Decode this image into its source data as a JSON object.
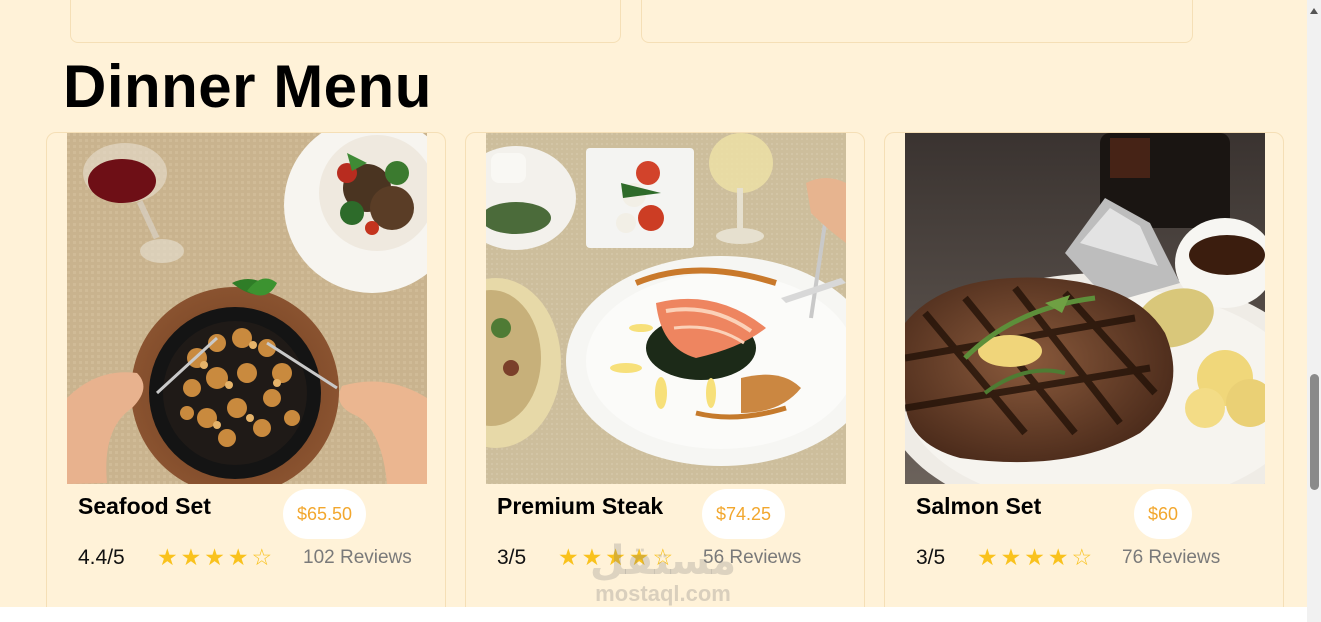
{
  "section": {
    "title": "Dinner Menu"
  },
  "menu_items": [
    {
      "name": "Seafood Set",
      "price": "$65.50",
      "rating": "4.4/5",
      "stars_filled": 4,
      "stars_total": 5,
      "reviews": "102 Reviews",
      "image": "seafood-skillet-photo"
    },
    {
      "name": "Premium Steak",
      "price": "$74.25",
      "rating": "3/5",
      "stars_filled": 4,
      "stars_total": 5,
      "reviews": "56 Reviews",
      "image": "salmon-plate-photo"
    },
    {
      "name": "Salmon Set",
      "price": "$60",
      "rating": "3/5",
      "stars_filled": 4,
      "stars_total": 5,
      "reviews": "76 Reviews",
      "image": "grilled-steak-photo"
    }
  ],
  "icons": {
    "star_filled": "★",
    "star_empty": "☆"
  },
  "colors": {
    "background": "#fff2d8",
    "price_text": "#f2a72e",
    "star": "#f9c21d"
  },
  "watermark": {
    "arabic": "مستقل",
    "latin": "mostaql.com"
  }
}
